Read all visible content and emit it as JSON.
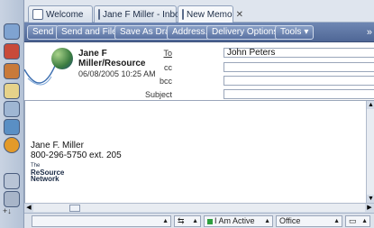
{
  "tabs": [
    {
      "label": "Welcome",
      "icon": "home-icon",
      "active": false
    },
    {
      "label": "Jane F Miller - Inbox",
      "icon": "inbox-icon",
      "active": false
    },
    {
      "label": "New Memo",
      "icon": "memo-icon",
      "active": true
    }
  ],
  "toolbar": {
    "send": "Send",
    "send_and_file": "Send and File...",
    "save_as_draft": "Save As Draft",
    "address": "Address...",
    "delivery_options": "Delivery Options...",
    "tools": "Tools"
  },
  "header": {
    "sender_line1": "Jane F",
    "sender_line2": "Miller/Resource",
    "date": "06/08/2005 10:25 AM",
    "to_label": "To",
    "to_value": "John Peters",
    "cc_label": "cc",
    "cc_value": "",
    "bcc_label": "bcc",
    "bcc_value": "",
    "subject_label": "Subject",
    "subject_value": ""
  },
  "body": {
    "sig_name": "Jane F. Miller",
    "sig_phone": "800-296-5750 ext. 205",
    "logo_the": "The",
    "logo_resource": "ReSource",
    "logo_network": "Network"
  },
  "status": {
    "presence": "I Am Active",
    "location": "Office"
  },
  "colors": {
    "toolbar_bg": "#5a72a2",
    "presence_dot": "#2e9e3e"
  }
}
